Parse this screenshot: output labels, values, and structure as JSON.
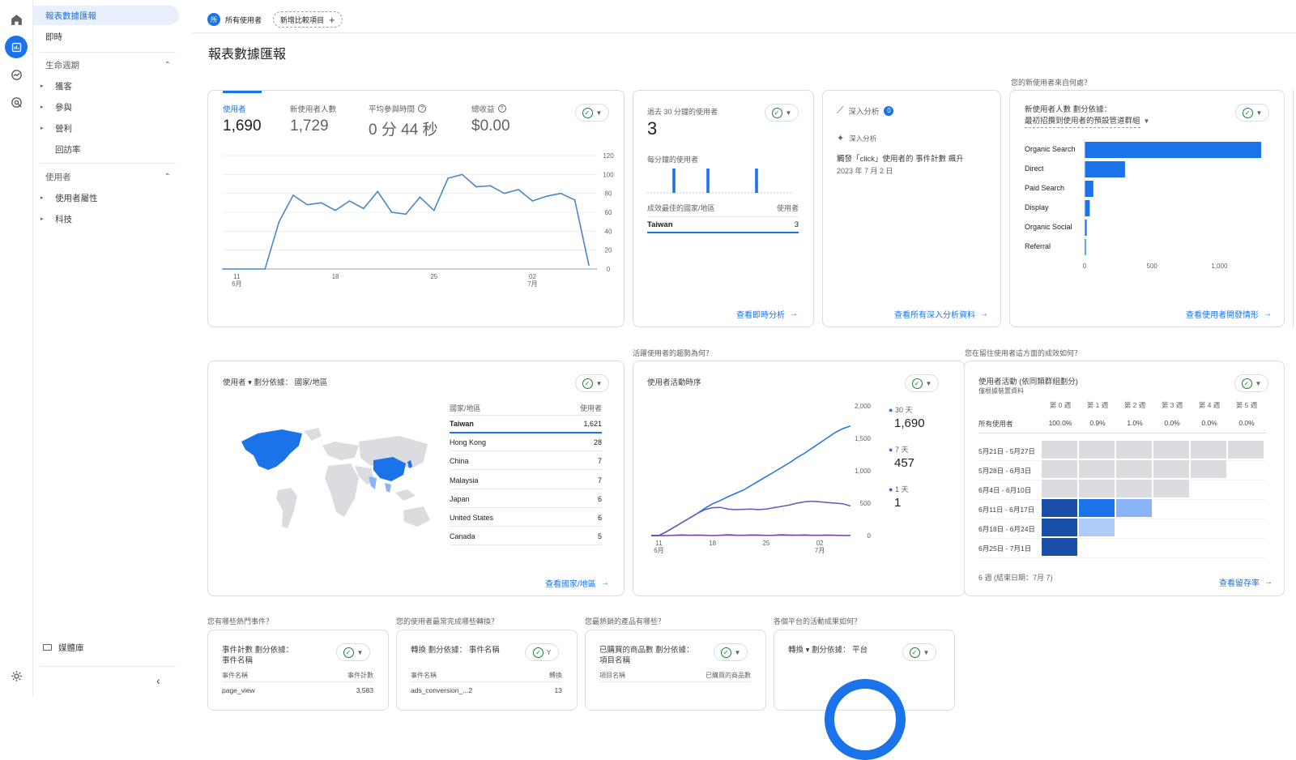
{
  "topbar": {
    "segment_badge": "所",
    "segment_label": "所有使用者",
    "add_compare_label": "新增比較項目"
  },
  "page_title": "報表數據匯報",
  "sidebar": {
    "items": [
      {
        "label": "報表數據匯報"
      },
      {
        "label": "即時"
      },
      {
        "label": "生命週期"
      },
      {
        "label": "獲客"
      },
      {
        "label": "參與"
      },
      {
        "label": "營利"
      },
      {
        "label": "回訪率"
      },
      {
        "label": "使用者"
      },
      {
        "label": "使用者屬性"
      },
      {
        "label": "科技"
      }
    ],
    "library_label": "媒體庫"
  },
  "overview_card": {
    "metrics": [
      {
        "label": "使用者",
        "value": "1,690"
      },
      {
        "label": "新使用者人數",
        "value": "1,729"
      },
      {
        "label": "平均參與時間",
        "value": "0 分 44 秒"
      },
      {
        "label": "總收益",
        "value": "$0.00"
      }
    ]
  },
  "realtime_card": {
    "title": "過去 30 分鐘的使用者",
    "value": "3",
    "subtitle": "每分鐘的使用者",
    "table_header_left": "成效最佳的國家/地區",
    "table_header_right": "使用者",
    "row_country": "Taiwan",
    "row_value": "3",
    "link": "查看即時分析"
  },
  "insights_card": {
    "title": "深入分析",
    "badge": "0",
    "sub": "深入分析",
    "text": "觸發「click」使用者的 事件計數 飆升",
    "date": "2023 年 7 月 2 日",
    "link": "查看所有深入分析資料"
  },
  "acquisition": {
    "question": "您的新使用者來自何處？",
    "title_line1": "新使用者人數 劃分依據：",
    "title_line2": "最初招攬到使用者的預設管道群組",
    "link": "查看使用者開發情形"
  },
  "geo_card": {
    "title": "使用者 ▾  劃分依據： 國家/地區",
    "col_left": "國家/地區",
    "col_right": "使用者",
    "rows": [
      {
        "country": "Taiwan",
        "value": "1,621"
      },
      {
        "country": "Hong Kong",
        "value": "28"
      },
      {
        "country": "China",
        "value": "7"
      },
      {
        "country": "Malaysia",
        "value": "7"
      },
      {
        "country": "Japan",
        "value": "6"
      },
      {
        "country": "United States",
        "value": "6"
      },
      {
        "country": "Canada",
        "value": "5"
      }
    ],
    "link": "查看國家/地區"
  },
  "trend_card": {
    "question": "活躍使用者的趨勢為何？",
    "title": "使用者活動時序",
    "legend": [
      {
        "label": "30 天",
        "value": "1,690"
      },
      {
        "label": "7 天",
        "value": "457"
      },
      {
        "label": "1 天",
        "value": "1"
      }
    ]
  },
  "cohort_card": {
    "question": "您在留住使用者這方面的成效如何？",
    "title": "使用者活動 (依同類群組劃分)",
    "subtitle": "僅根據裝置資料",
    "weeks": [
      "第 0 週",
      "第 1 週",
      "第 2 週",
      "第 3 週",
      "第 4 週",
      "第 5 週"
    ],
    "all_users_label": "所有使用者",
    "all_users_values": [
      "100.0%",
      "0.9%",
      "1.0%",
      "0.0%",
      "0.0%",
      "0.0%"
    ],
    "rows": [
      "5月21日 - 5月27日",
      "5月28日 - 6月3日",
      "6月4日 - 6月10日",
      "6月11日 - 6月17日",
      "6月18日 - 6月24日",
      "6月25日 - 7月1日"
    ],
    "footer": "6 週 (結束日期：7月 7)",
    "link": "查看留存率"
  },
  "bottom_cards": [
    {
      "question": "您有哪些熱門事件？",
      "title": "事件計數 劃分依據：",
      "title2": "事件名稱",
      "col_left": "事件名稱",
      "col_right": "事件計數",
      "row_left": "page_view",
      "row_right": "3,583"
    },
    {
      "question": "您的使用者最常完成哪些轉換？",
      "title": "轉換 劃分依據： 事件名稱",
      "title2": "",
      "col_left": "事件名稱",
      "col_right": "轉換",
      "row_left": "ads_conversion_...2",
      "row_right": "13"
    },
    {
      "question": "您最熱銷的產品有哪些？",
      "title": "已購買的商品數 劃分依據：",
      "title2": "項目名稱",
      "col_left": "項目名稱",
      "col_right": "已購買的商品數",
      "row_left": "",
      "row_right": ""
    },
    {
      "question": "各個平台的活動成果如何？",
      "title": "轉換 ▾  劃分依據： 平台",
      "title2": "",
      "col_left": "",
      "col_right": "",
      "row_left": "",
      "row_right": ""
    }
  ],
  "colors": {
    "accent": "#1a73e8",
    "line": "#4a86c8",
    "ok": "#188038",
    "dark_cell": "#1a4fa8",
    "mid_cell": "#1a73e8",
    "light_cell": "#8ab4f8",
    "lighter_cell": "#aecbfa",
    "grey_cell": "#dadce0"
  },
  "chart_data": [
    {
      "type": "line",
      "title": "",
      "x": [
        "6月10日",
        "6月11日",
        "6月12日",
        "6月13日",
        "6月14日",
        "6月15日",
        "6月16日",
        "6月17日",
        "6月18日",
        "6月19日",
        "6月20日",
        "6月21日",
        "6月22日",
        "6月23日",
        "6月24日",
        "6月25日",
        "6月26日",
        "6月27日",
        "6月28日",
        "6月29日",
        "6月30日",
        "7月1日",
        "7月2日",
        "7月3日",
        "7月4日",
        "7月5日",
        "7月6日"
      ],
      "series": [
        {
          "values": [
            0,
            0,
            0,
            0,
            50,
            78,
            68,
            70,
            62,
            72,
            64,
            82,
            60,
            58,
            76,
            62,
            96,
            100,
            87,
            88,
            80,
            84,
            72,
            77,
            80,
            73,
            4
          ]
        }
      ],
      "x_tick_labels": [
        {
          "label": "11",
          "sub": "6月"
        },
        {
          "label": "18",
          "sub": ""
        },
        {
          "label": "25",
          "sub": ""
        },
        {
          "label": "02",
          "sub": "7月"
        }
      ],
      "ylim": [
        0,
        120
      ],
      "y_ticks": [
        0,
        20,
        40,
        60,
        80,
        100,
        120
      ]
    },
    {
      "type": "bar",
      "title": "每分鐘的使用者",
      "categories": [
        "-29",
        "-28",
        "-27",
        "-26",
        "-25",
        "-24",
        "-23",
        "-22",
        "-21",
        "-20",
        "-19",
        "-18",
        "-17",
        "-16",
        "-15",
        "-14",
        "-13",
        "-12",
        "-11",
        "-10",
        "-9",
        "-8",
        "-7",
        "-6",
        "-5",
        "-4",
        "-3",
        "-2",
        "-1",
        "0"
      ],
      "values": [
        0,
        0,
        0,
        0,
        0,
        1,
        0,
        0,
        0,
        0,
        0,
        0,
        1,
        0,
        0,
        0,
        0,
        0,
        0,
        0,
        0,
        0,
        1,
        0,
        0,
        0,
        0,
        0,
        0,
        0
      ]
    },
    {
      "type": "bar",
      "orientation": "horizontal",
      "categories": [
        "Organic Search",
        "Direct",
        "Paid Search",
        "Display",
        "Organic Social",
        "Referral"
      ],
      "values": [
        1310,
        300,
        65,
        38,
        16,
        10
      ],
      "xlim": [
        0,
        1250
      ],
      "x_ticks": [
        "0",
        "500",
        "1,000"
      ]
    },
    {
      "type": "line",
      "title": "使用者活動時序",
      "x_tick_labels": [
        {
          "label": "11",
          "sub": "6月"
        },
        {
          "label": "18",
          "sub": ""
        },
        {
          "label": "25",
          "sub": ""
        },
        {
          "label": "02",
          "sub": "7月"
        }
      ],
      "ylim": [
        0,
        2000
      ],
      "y_ticks": [
        "0",
        "500",
        "1,000",
        "1,500",
        "2,000"
      ],
      "series": [
        {
          "name": "30 天",
          "values": [
            0,
            0,
            60,
            130,
            200,
            270,
            340,
            420,
            490,
            540,
            600,
            650,
            700,
            770,
            840,
            910,
            980,
            1050,
            1120,
            1200,
            1270,
            1350,
            1430,
            1510,
            1590,
            1650,
            1690
          ]
        },
        {
          "name": "7 天",
          "values": [
            0,
            0,
            60,
            130,
            200,
            270,
            340,
            400,
            430,
            435,
            410,
            400,
            405,
            410,
            400,
            410,
            430,
            450,
            470,
            500,
            520,
            530,
            520,
            510,
            500,
            490,
            457
          ]
        },
        {
          "name": "1 天",
          "values": [
            0,
            0,
            0,
            5,
            10,
            5,
            8,
            4,
            0,
            5,
            12,
            6,
            4,
            10,
            8,
            3,
            5,
            12,
            8,
            6,
            10,
            4,
            5,
            8,
            4,
            2,
            1
          ]
        }
      ]
    },
    {
      "type": "heatmap",
      "title": "使用者活動 (依同類群組劃分)",
      "rows": [
        "5月21日 - 5月27日",
        "5月28日 - 6月3日",
        "6月4日 - 6月10日",
        "6月11日 - 6月17日",
        "6月18日 - 6月24日",
        "6月25日 - 7月1日"
      ],
      "columns": [
        "第 0 週",
        "第 1 週",
        "第 2 週",
        "第 3 週",
        "第 4 週",
        "第 5 週"
      ],
      "levels": [
        [
          0,
          0,
          0,
          0,
          0,
          0
        ],
        [
          0,
          0,
          0,
          0,
          0,
          null
        ],
        [
          0,
          0,
          0,
          0,
          null,
          null
        ],
        [
          3,
          2,
          1,
          null,
          null,
          null
        ],
        [
          3,
          0.5,
          null,
          null,
          null,
          null
        ],
        [
          3,
          null,
          null,
          null,
          null,
          null
        ]
      ]
    }
  ]
}
